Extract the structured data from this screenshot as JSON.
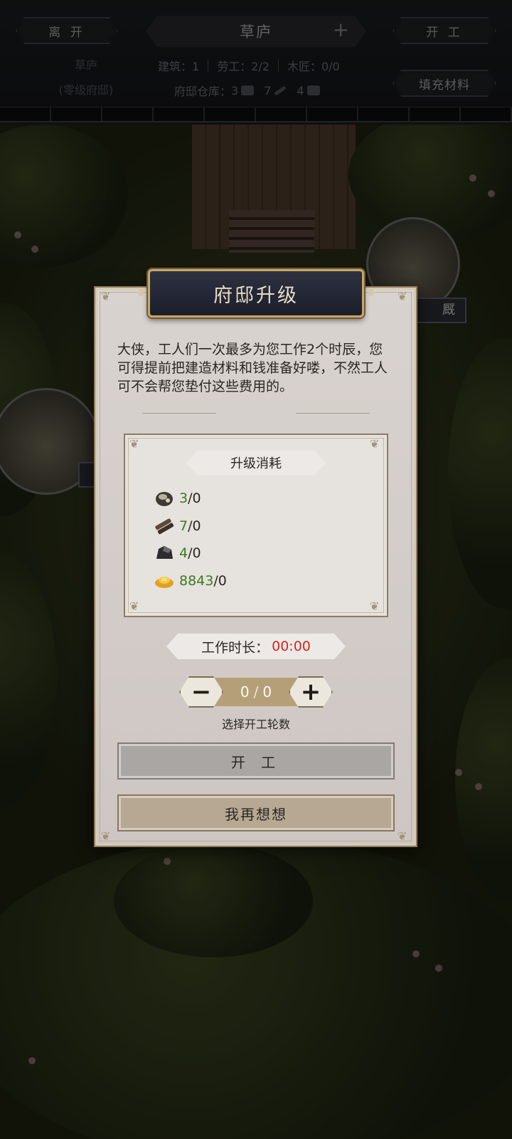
{
  "header": {
    "leave_label": "离 开",
    "title": "草庐",
    "add_icon": "plus-icon",
    "start_label": "开 工",
    "fill_materials_label": "填充材料",
    "house_name": "草庐",
    "house_level": "(零级府邸)",
    "stats": {
      "building": "建筑：1",
      "labor": "劳工：2/2",
      "carpenter": "木匠：0/0"
    },
    "warehouse_label": "府邸仓库：",
    "warehouse_items": [
      {
        "count": "3",
        "icon": "stone-icon"
      },
      {
        "count": "7",
        "icon": "wood-icon"
      },
      {
        "count": "4",
        "icon": "iron-icon"
      }
    ]
  },
  "scene": {
    "side_tag": "厩"
  },
  "dialog": {
    "title": "府邸升级",
    "intro": "大侠，工人们一次最多为您工作2个时辰，您可得提前把建造材料和钱准备好喽，不然工人可不会帮您垫付这些费用的。",
    "cost_title": "升级消耗",
    "costs": [
      {
        "icon": "stone-icon",
        "have": "3",
        "need": "/0"
      },
      {
        "icon": "wood-icon",
        "have": "7",
        "need": "/0"
      },
      {
        "icon": "iron-ore-icon",
        "have": "4",
        "need": "/0"
      },
      {
        "icon": "gold-ingot-icon",
        "have": "8843",
        "need": "/0"
      }
    ],
    "duration_label": "工作时长：",
    "duration_value": "00:00",
    "rounds_current": "0",
    "rounds_sep": "/",
    "rounds_max": "0",
    "rounds_caption": "选择开工轮数",
    "minus_label": "−",
    "plus_label": "+",
    "start_button": "开 工",
    "cancel_button": "我再想想"
  },
  "colors": {
    "have_green": "#3a7b1f",
    "duration_red": "#d6281e",
    "title_gold": "#c7a768"
  }
}
